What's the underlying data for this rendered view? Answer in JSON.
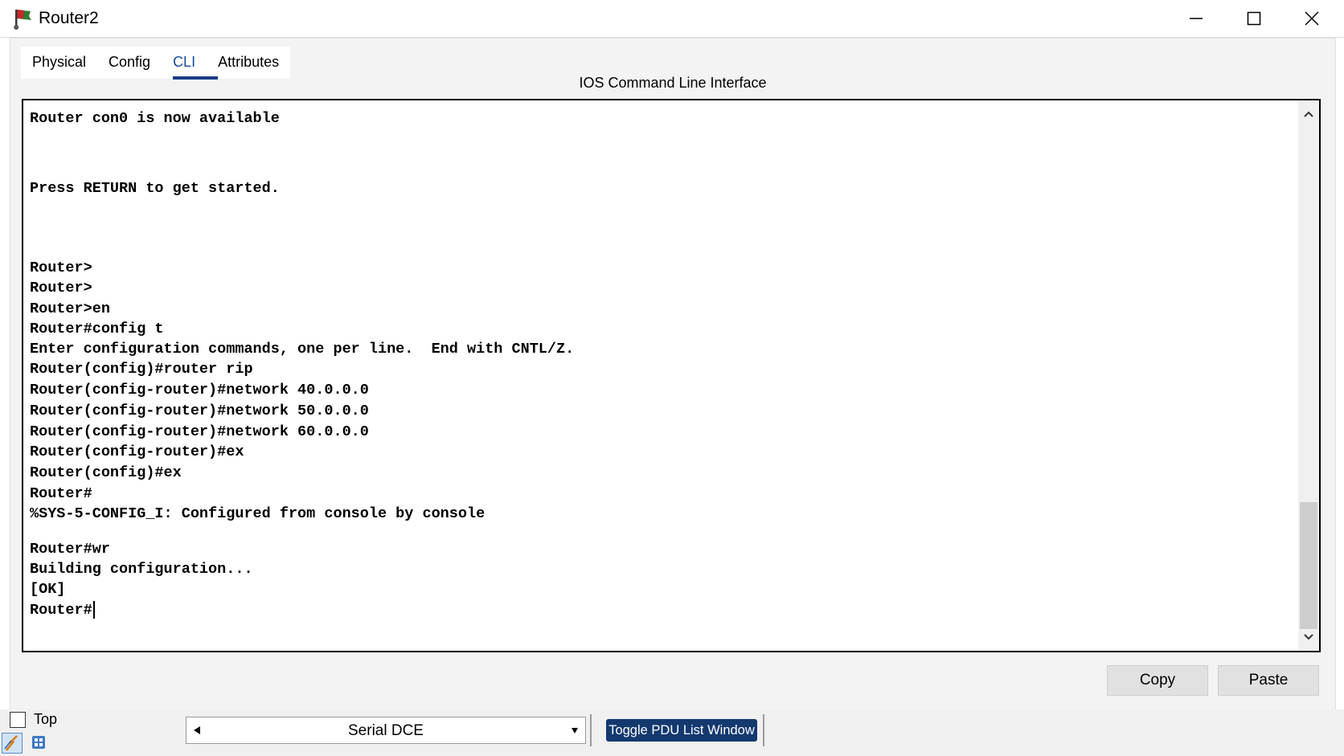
{
  "window": {
    "title": "Router2"
  },
  "tabs": [
    {
      "label": "Physical",
      "active": false
    },
    {
      "label": "Config",
      "active": false
    },
    {
      "label": "CLI",
      "active": true
    },
    {
      "label": "Attributes",
      "active": false
    }
  ],
  "cli": {
    "heading": "IOS Command Line Interface",
    "lines": [
      "Router con0 is now available",
      "Press RETURN to get started.",
      "Router>",
      "Router>",
      "Router>en",
      "Router#config t",
      "Enter configuration commands, one per line.  End with CNTL/Z.",
      "Router(config)#router rip",
      "Router(config-router)#network 40.0.0.0",
      "Router(config-router)#network 50.0.0.0",
      "Router(config-router)#network 60.0.0.0",
      "Router(config-router)#ex",
      "Router(config)#ex",
      "Router#",
      "%SYS-5-CONFIG_I: Configured from console by console",
      "Router#wr",
      "Building configuration...",
      "[OK]",
      "Router#"
    ]
  },
  "actions": {
    "copy": "Copy",
    "paste": "Paste"
  },
  "bottom": {
    "top_label": "Top",
    "top_checked": false,
    "link_type": "Serial DCE",
    "toggle_pdu": "Toggle PDU List Window"
  },
  "colors": {
    "active_tab": "#1a4ca0",
    "toggle_button_bg": "#13396f"
  }
}
